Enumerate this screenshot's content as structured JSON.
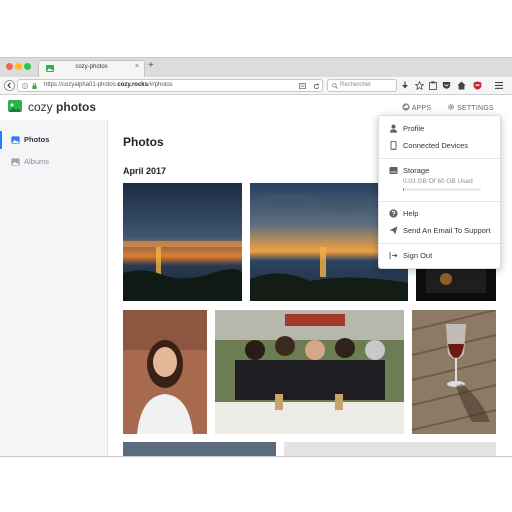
{
  "browser": {
    "tab_title": "cozy-photos",
    "tab_close": "×",
    "new_tab": "+",
    "url_prefix": "https://cozyalpha01-photos.",
    "url_domain": "cozy.rocks",
    "url_suffix": "/#/photos",
    "search_placeholder": "Rechercher"
  },
  "app": {
    "brand_light": "cozy",
    "brand_bold": "photos",
    "apps_label": "APPS",
    "settings_label": "SETTINGS"
  },
  "sidebar": {
    "items": [
      {
        "label": "Photos",
        "active": true,
        "icon": "photos-icon"
      },
      {
        "label": "Albums",
        "active": false,
        "icon": "albums-icon"
      }
    ]
  },
  "main": {
    "title": "Photos",
    "month": "April 2017"
  },
  "settings_menu": {
    "profile": "Profile",
    "connected_devices": "Connected Devices",
    "storage": "Storage",
    "storage_usage": "0.03 GB Of 60 GB Used",
    "storage_fraction": 0.0005,
    "help": "Help",
    "support": "Send An Email To Support",
    "sign_out": "Sign Out"
  },
  "colors": {
    "accent": "#297ef2",
    "brand_green": "#2bb34b"
  }
}
